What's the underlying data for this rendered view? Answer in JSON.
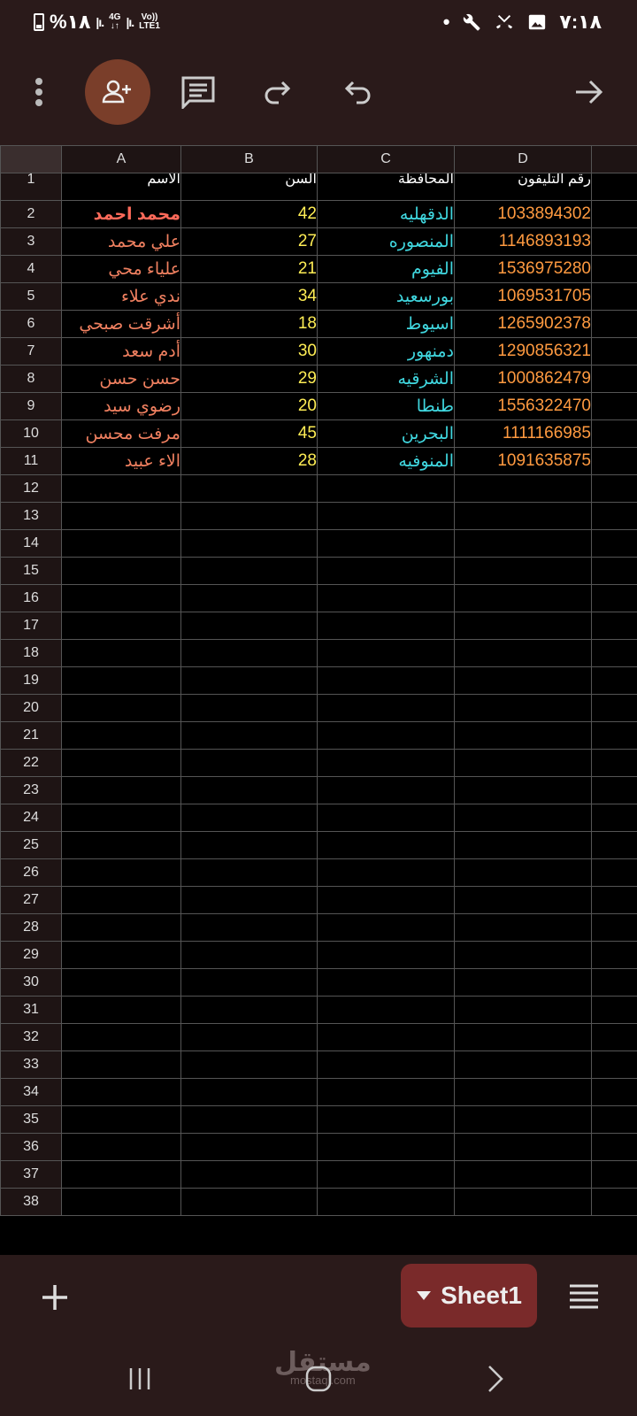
{
  "status_bar": {
    "battery": "%١٨",
    "signal_1": "|ı.",
    "network_1": "4G",
    "signal_2": "|ı.",
    "network_2_top": "Vo))",
    "network_2_bottom": "LTE1",
    "time": "٧:١٨"
  },
  "toolbar": {
    "icons": [
      "more-vert-icon",
      "add-person-icon",
      "comment-icon",
      "redo-icon",
      "undo-icon",
      "forward-arrow-icon"
    ]
  },
  "columns": [
    "A",
    "B",
    "C",
    "D"
  ],
  "header_row": {
    "row": "1",
    "name": "الاسم",
    "age": "السن",
    "governorate": "المحافظة",
    "phone": "رقم التليفون"
  },
  "rows": [
    {
      "row": "2",
      "name": "محمد احمد",
      "age": "42",
      "governorate": "الدقهليه",
      "phone": "1033894302"
    },
    {
      "row": "3",
      "name": "علي محمد",
      "age": "27",
      "governorate": "المنصوره",
      "phone": "1146893193"
    },
    {
      "row": "4",
      "name": "علياء محي",
      "age": "21",
      "governorate": "الفيوم",
      "phone": "1536975280"
    },
    {
      "row": "5",
      "name": "ندي علاء",
      "age": "34",
      "governorate": "بورسعيد",
      "phone": "1069531705"
    },
    {
      "row": "6",
      "name": "أشرقت صبحي",
      "age": "18",
      "governorate": "اسيوط",
      "phone": "1265902378"
    },
    {
      "row": "7",
      "name": "أدم سعد",
      "age": "30",
      "governorate": "دمنهور",
      "phone": "1290856321"
    },
    {
      "row": "8",
      "name": "حسن حسن",
      "age": "29",
      "governorate": "الشرقيه",
      "phone": "1000862479"
    },
    {
      "row": "9",
      "name": "رضوي سيد",
      "age": "20",
      "governorate": "طنطا",
      "phone": "1556322470"
    },
    {
      "row": "10",
      "name": "مرفت محسن",
      "age": "45",
      "governorate": "البحرين",
      "phone": "1111166985"
    },
    {
      "row": "11",
      "name": "الاء عبيد",
      "age": "28",
      "governorate": "المنوفيه",
      "phone": "1091635875"
    }
  ],
  "empty_rows": [
    "12",
    "13",
    "14",
    "15",
    "16",
    "17",
    "18",
    "19",
    "20",
    "21",
    "22",
    "23",
    "24",
    "25",
    "26",
    "27",
    "28",
    "29",
    "30",
    "31",
    "32",
    "33",
    "34",
    "35",
    "36",
    "37",
    "38"
  ],
  "bottom_bar": {
    "sheet_name": "Sheet1"
  },
  "nav_bar": {
    "watermark": "مستقل",
    "watermark_sub": "mostaql.com"
  },
  "colors": {
    "name": "#f08060",
    "age": "#ffee55",
    "governorate": "#40d8e0",
    "phone": "#ff9a40",
    "sheet_tab": "#7a2a2a",
    "share_button": "#7a3e2a"
  }
}
